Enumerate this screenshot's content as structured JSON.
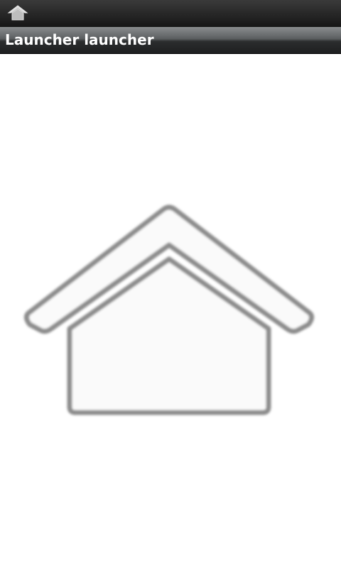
{
  "status_bar": {
    "icon": "home-icon",
    "background": "#1e1e1e"
  },
  "title_bar": {
    "title": "Launcher launcher"
  },
  "main": {
    "launcher_icon": "home-icon",
    "icon_stroke_color": "#8c8c8c",
    "background": "#ffffff"
  }
}
